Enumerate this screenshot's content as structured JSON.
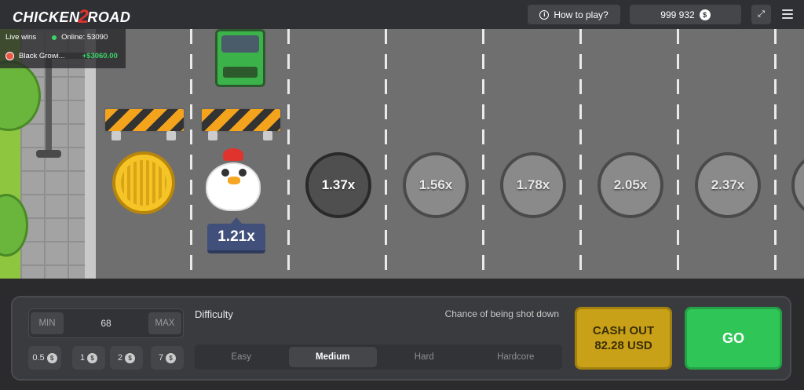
{
  "header": {
    "logo_text": "CHICKEN",
    "logo_number": "2",
    "logo_text2": "ROAD",
    "how_to_play_label": "How to play?",
    "balance": "999 932",
    "currency_symbol": "$"
  },
  "live": {
    "label": "Live wins",
    "online_text": "Online: 53090",
    "player_name": "Black Growi...",
    "player_win": "+$3060.00"
  },
  "game": {
    "current_multiplier": "1.21x",
    "multipliers": [
      "1.37x",
      "1.56x",
      "1.78x",
      "2.05x",
      "2.37x"
    ]
  },
  "controls": {
    "min_label": "MIN",
    "max_label": "MAX",
    "bet_value": "68",
    "quick_bets": [
      "0.5",
      "1",
      "2",
      "7"
    ],
    "difficulty_label": "Difficulty",
    "chance_label": "Chance of being shot down",
    "difficulties": [
      "Easy",
      "Medium",
      "Hard",
      "Hardcore"
    ],
    "selected_difficulty": "Medium",
    "cashout_line1": "CASH OUT",
    "cashout_line2": "82.28 USD",
    "go_label": "GO"
  },
  "colors": {
    "go": "#2fc657",
    "cashout": "#c9a118",
    "win_green": "#3bd36a",
    "multiplier_tag": "#41507a"
  }
}
